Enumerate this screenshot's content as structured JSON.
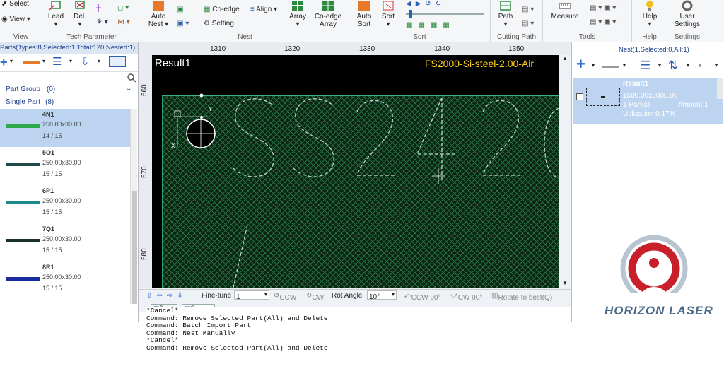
{
  "ribbon": {
    "view": {
      "select": "Select",
      "view": "View",
      "group": "View"
    },
    "tech": {
      "lead": "Lead",
      "del": "Del.",
      "group": "Tech Parameter"
    },
    "nest": {
      "auto_nest_l1": "Auto",
      "auto_nest_l2": "Nest",
      "co_edge": "Co-edge",
      "align": "Align",
      "setting": "Setting",
      "array": "Array",
      "co_edge_array_l1": "Co-edge",
      "co_edge_array_l2": "Array",
      "group": "Nest"
    },
    "sort": {
      "auto_sort_l1": "Auto",
      "auto_sort_l2": "Sort",
      "sort": "Sort",
      "group": "Sort"
    },
    "cutting": {
      "path": "Path",
      "group": "Cutting Path"
    },
    "tools": {
      "measure": "Measure",
      "group": "Tools"
    },
    "help": {
      "help": "Help",
      "group": "Help"
    },
    "settings": {
      "user_l1": "User",
      "user_l2": "Settings",
      "group": "Settings"
    }
  },
  "left": {
    "title": "Parts(Types:8,Selected:1,Total:120,Nested:1)",
    "groups": [
      {
        "label": "Part Group",
        "count": "(0)"
      },
      {
        "label": "Single Part",
        "count": "(8)"
      }
    ],
    "parts": [
      {
        "name": "4N1",
        "size": "250.00x30.00",
        "count": "14 / 15",
        "color": "#2aa84a"
      },
      {
        "name": "5O1",
        "size": "250.00x30.00",
        "count": "15 / 15",
        "color": "#1f4a4a"
      },
      {
        "name": "6P1",
        "size": "250.00x30.00",
        "count": "15 / 15",
        "color": "#1a8a8a"
      },
      {
        "name": "7Q1",
        "size": "250.00x30.00",
        "count": "15 / 15",
        "color": "#1c3030"
      },
      {
        "name": "8R1",
        "size": "250.00x30.00",
        "count": "15 / 15",
        "color": "#1a2aa0"
      }
    ]
  },
  "ruler": {
    "x": [
      "1310",
      "1320",
      "1330",
      "1340",
      "1350"
    ],
    "y": [
      "560",
      "570",
      "580"
    ]
  },
  "canvas": {
    "result": "Result1",
    "material": "FS2000-Si-steel-2.00-Air",
    "axis_y": "Y",
    "axis_x": "X"
  },
  "finetune": {
    "label": "Fine-tune",
    "value": "1",
    "ccw": "CCW",
    "cw": "CW",
    "rot_label": "Rot Angle",
    "rot_value": "10°",
    "ccw90": "CCW 90°",
    "cw90": "CW 90°",
    "best": "Rotate to best(Q)"
  },
  "cmd": {
    "tabs": [
      "Draw",
      "System"
    ],
    "lines": [
      "*Cancel*",
      "Command: Remove Selected Part(All) and Delete",
      "Command: Batch Import Part",
      "Command: Nest Manually",
      "*Cancel*",
      "Command: Remove Selected Part(All) and Delete"
    ]
  },
  "right": {
    "title": "Nest(1,Selected:0,All:1)",
    "result": {
      "name": "Result1",
      "size": "1500.00x3000.00",
      "parts": "1 Part(s)",
      "amount": "Amount:1",
      "util": "Utilization:0.17%"
    }
  },
  "watermark": "HORIZON LASER"
}
